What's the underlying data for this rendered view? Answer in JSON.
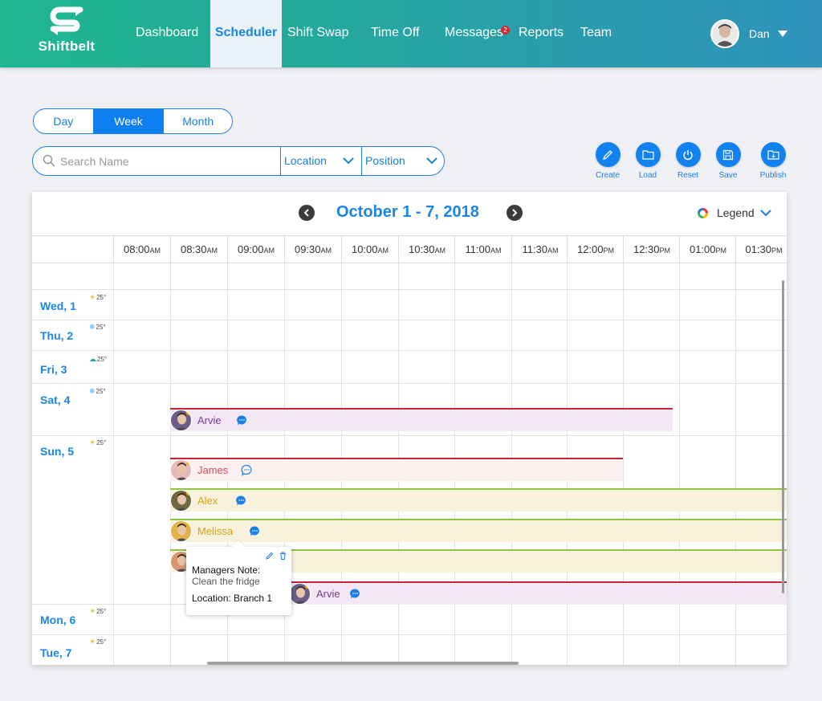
{
  "app": {
    "name": "Shiftbelt"
  },
  "nav": {
    "items": [
      {
        "label": "Dashboard",
        "active": false
      },
      {
        "label": "Scheduler",
        "active": true
      },
      {
        "label": "Shift Swap",
        "active": false
      },
      {
        "label": "Time Off",
        "active": false
      },
      {
        "label": "Messages",
        "active": false,
        "badge": "2"
      },
      {
        "label": "Reports",
        "active": false
      },
      {
        "label": "Team",
        "active": false
      }
    ],
    "user": {
      "name": "Dan"
    }
  },
  "view_toggle": {
    "day": "Day",
    "week": "Week",
    "month": "Month",
    "selected": "Week"
  },
  "filters": {
    "search_placeholder": "Search Name",
    "location": "Location",
    "position": "Position"
  },
  "actions": {
    "create": "Create",
    "load": "Load",
    "reset": "Reset",
    "save": "Save",
    "publish": "Publish"
  },
  "calendar": {
    "title": "October 1 - 7, 2018",
    "legend": "Legend",
    "times": [
      {
        "t": "08:00",
        "p": "AM"
      },
      {
        "t": "08:30",
        "p": "AM"
      },
      {
        "t": "09:00",
        "p": "AM"
      },
      {
        "t": "09:30",
        "p": "AM"
      },
      {
        "t": "10:00",
        "p": "AM"
      },
      {
        "t": "10:30",
        "p": "AM"
      },
      {
        "t": "11:00",
        "p": "AM"
      },
      {
        "t": "11:30",
        "p": "AM"
      },
      {
        "t": "12:00",
        "p": "PM"
      },
      {
        "t": "12:30",
        "p": "PM"
      },
      {
        "t": "01:00",
        "p": "PM"
      },
      {
        "t": "01:30",
        "p": "PM"
      }
    ],
    "days": [
      {
        "label": "Wed, 1",
        "weather": "sun",
        "temp": "25°"
      },
      {
        "label": "Thu, 2",
        "weather": "snow",
        "temp": "25°"
      },
      {
        "label": "Fri, 3",
        "weather": "cloud",
        "temp": "25°"
      },
      {
        "label": "Sat, 4",
        "weather": "snow",
        "temp": "25°"
      },
      {
        "label": "Sun, 5",
        "weather": "sun",
        "temp": "25°"
      },
      {
        "label": "Mon, 6",
        "weather": "sun",
        "temp": "25°"
      },
      {
        "label": "Tue, 7",
        "weather": "sun",
        "temp": "25°"
      }
    ],
    "shifts": [
      {
        "name": "Arvie",
        "day": "Sat, 4",
        "color": "#7a3a96",
        "bar": "#f3e7f4",
        "line": "#c2243a"
      },
      {
        "name": "James",
        "day": "Sun, 5",
        "color": "#e4495c",
        "bar": "#fbeff0",
        "line": "#c2243a"
      },
      {
        "name": "Alex",
        "day": "Sun, 5",
        "color": "#d4a312",
        "bar": "#f8f1dc",
        "line": "#8bc541"
      },
      {
        "name": "Melissa",
        "day": "Sun, 5",
        "color": "#d4a312",
        "bar": "#f8f1dc",
        "line": "#8bc541"
      },
      {
        "name": "",
        "day": "Sun, 5",
        "color": "#d4a312",
        "bar": "#f8f1dc",
        "line": "#8bc541"
      },
      {
        "name": "Arvie",
        "day": "Sun, 5",
        "color": "#7a3a96",
        "bar": "#f3e7f4",
        "line": "#c2243a"
      }
    ],
    "note": {
      "title": "Managers Note:",
      "body": "Clean the fridge",
      "location": "Location: Branch 1"
    }
  },
  "colors": {
    "accent": "#1886e8",
    "brand_start": "#1fb68f",
    "brand_end": "#2f93bb"
  }
}
